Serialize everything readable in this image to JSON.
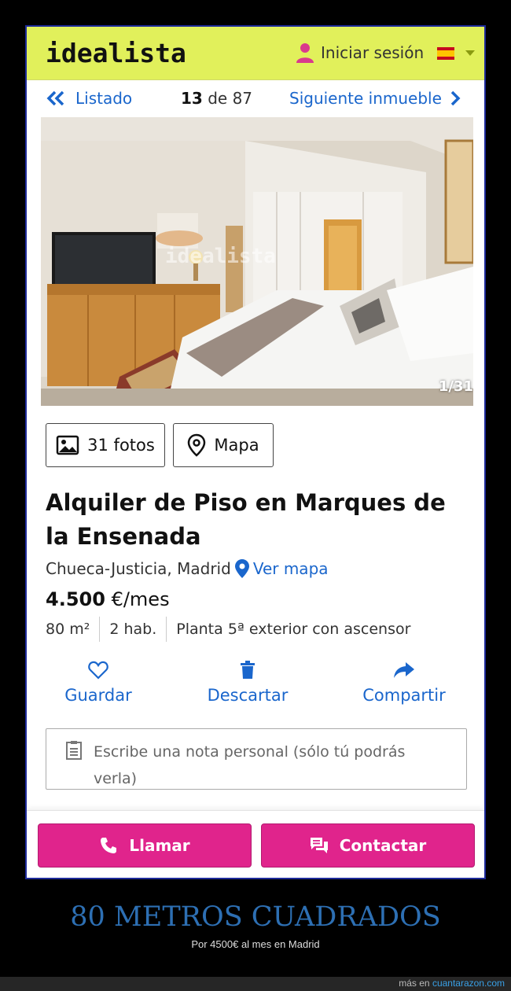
{
  "header": {
    "logo": "idealista",
    "login_label": "Iniciar sesión",
    "language_flag": "es-flag-icon"
  },
  "nav": {
    "back_label": "Listado",
    "current": "13",
    "of_word": "de",
    "total": "87",
    "next_label": "Siguiente inmueble"
  },
  "gallery": {
    "counter": "1/31",
    "watermark": "idealista",
    "photos_button": "31 fotos",
    "map_button": "Mapa"
  },
  "listing": {
    "title": "Alquiler de Piso en Marques de la Ensenada",
    "location": "Chueca-Justicia, Madrid",
    "map_link": "Ver mapa",
    "price_amount": "4.500",
    "price_unit": "€/mes",
    "features": [
      "80 m²",
      "2 hab.",
      "Planta 5ª exterior con ascensor"
    ]
  },
  "actions": {
    "save": "Guardar",
    "discard": "Descartar",
    "share": "Compartir"
  },
  "note": {
    "placeholder": "Escribe una nota personal (sólo tú podrás verla)"
  },
  "cta": {
    "call": "Llamar",
    "contact": "Contactar"
  },
  "caption": {
    "title": "80 METROS CUADRADOS",
    "subtitle": "Por 4500€ al mes en Madrid"
  },
  "site": {
    "prefix": "más en",
    "domain": "cuantarazon.com"
  },
  "colors": {
    "header_bg": "#e1f05b",
    "link_blue": "#1a66cc",
    "cta_pink": "#e0248c",
    "caption_blue": "#2d6fb3"
  }
}
